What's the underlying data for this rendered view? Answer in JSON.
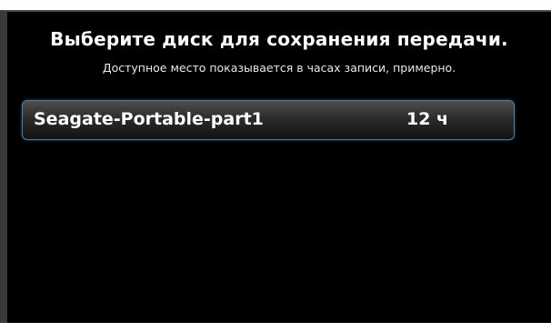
{
  "dialog": {
    "title": "Выберите диск для сохранения передачи.",
    "subtitle": "Доступное место показывается в часах записи, примерно."
  },
  "disks": [
    {
      "name": "Seagate-Portable-part1",
      "space": "12 ч"
    }
  ],
  "colors": {
    "background": "#000000",
    "text": "#ffffff",
    "selection_border": "#4a7fa8"
  }
}
